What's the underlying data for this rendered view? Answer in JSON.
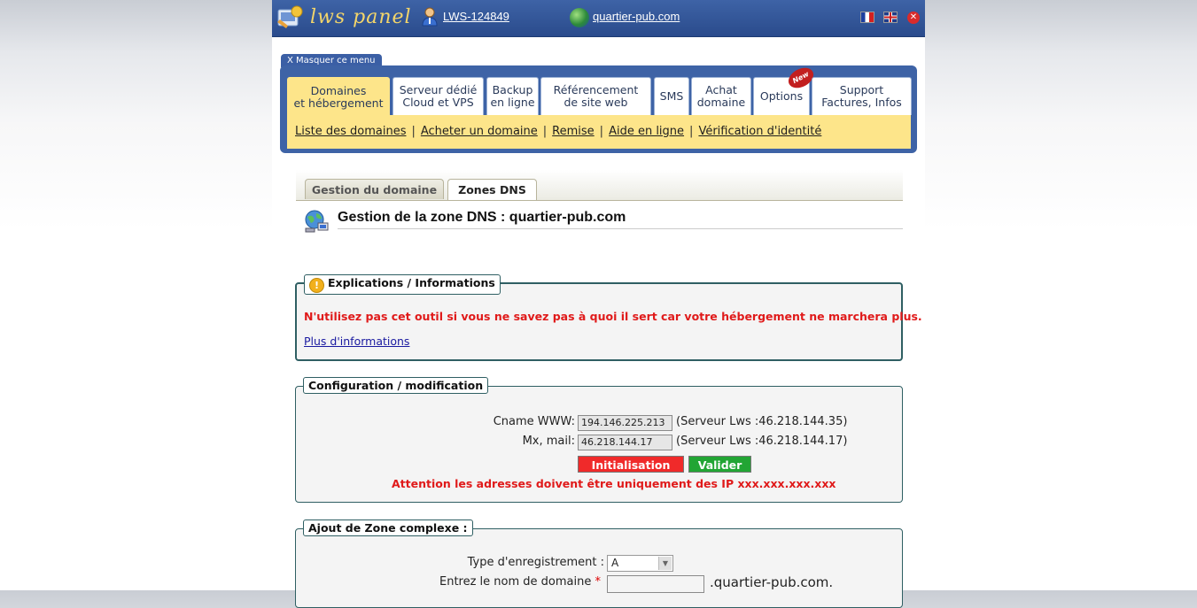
{
  "header": {
    "logo_text": "lws panel",
    "account_link": "LWS-124849",
    "domain_link": "quartier-pub.com",
    "colors": {
      "bar": "#2f5298",
      "logo": "#f3d56a"
    }
  },
  "menu": {
    "hide_label": "X Masquer ce menu",
    "tabs": [
      {
        "line1": "Domaines",
        "line2": "et hébergement"
      },
      {
        "line1": "Serveur dédié",
        "line2": "Cloud et VPS"
      },
      {
        "line1": "Backup",
        "line2": "en ligne"
      },
      {
        "line1": "Référencement",
        "line2": "de site web"
      },
      {
        "line1": "SMS",
        "line2": ""
      },
      {
        "line1": "Achat",
        "line2": "domaine"
      },
      {
        "line1": "Options",
        "line2": ""
      },
      {
        "line1": "Support",
        "line2": "Factures, Infos"
      }
    ],
    "new_badge": "New",
    "sublinks": [
      "Liste des domaines",
      "Acheter un domaine",
      "Remise",
      "Aide en ligne",
      "Vérification d'identité"
    ],
    "separator": "|"
  },
  "inner_tabs": [
    "Gestion du domaine",
    "Zones DNS"
  ],
  "page_title": "Gestion de la zone DNS : quartier-pub.com",
  "explanations": {
    "legend": "Explications / Informations",
    "warning": "N'utilisez pas cet outil si vous ne savez pas à quoi il sert car votre hébergement ne marchera plus.",
    "more_link": "Plus d'informations"
  },
  "config": {
    "legend": "Configuration / modification",
    "cname_label": "Cname WWW:",
    "cname_value": "194.146.225.213",
    "cname_note": "(Serveur Lws :46.218.144.35)",
    "mx_label": "Mx, mail:",
    "mx_value": "46.218.144.17",
    "mx_note": "(Serveur Lws :46.218.144.17)",
    "init_button": "Initialisation",
    "validate_button": "Valider",
    "attention": "Attention les adresses doivent être uniquement des IP xxx.xxx.xxx.xxx"
  },
  "complex": {
    "legend": "Ajout de Zone complexe :",
    "type_label": "Type d'enregistrement :",
    "type_value": "A",
    "domain_label": "Entrez le nom de domaine",
    "required_mark": "*",
    "domain_suffix": ".quartier-pub.com."
  }
}
